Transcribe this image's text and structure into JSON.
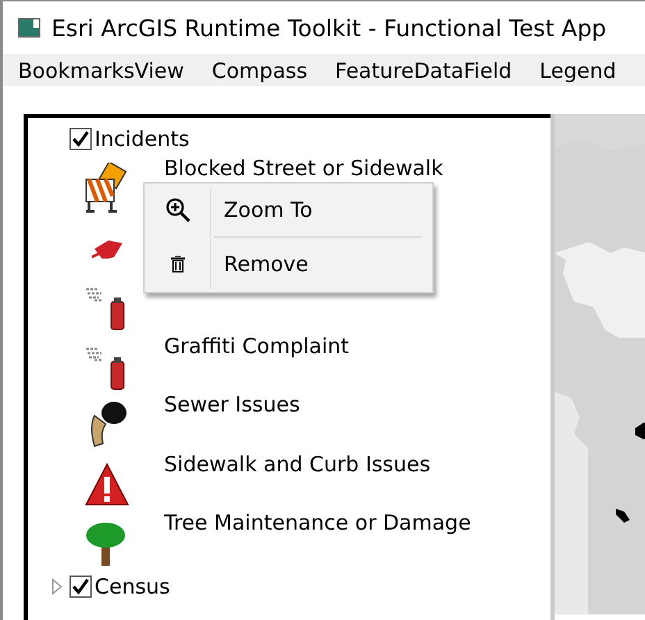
{
  "window": {
    "title": "Esri ArcGIS Runtime Toolkit - Functional Test App"
  },
  "menu_bar": [
    "BookmarksView",
    "Compass",
    "FeatureDataField",
    "Legend"
  ],
  "legend": {
    "layers": [
      {
        "label": "Incidents",
        "checked": true,
        "expanded": true,
        "children": [
          {
            "label": "Blocked Street or Sidewalk",
            "kind": "barricade"
          },
          {
            "kind": "leaf"
          },
          {
            "kind": "spray"
          },
          {
            "label": "Graffiti Complaint",
            "kind": "spray"
          },
          {
            "label": "Sewer Issues",
            "kind": "pipe"
          },
          {
            "label": "Sidewalk and Curb Issues",
            "kind": "warning"
          },
          {
            "label": "Tree Maintenance or Damage",
            "kind": "tree"
          }
        ]
      },
      {
        "label": "Census",
        "checked": true,
        "expanded": false
      }
    ]
  },
  "context_menu": {
    "items": [
      {
        "label": "Zoom To",
        "kind": "zoom"
      },
      {
        "label": "Remove",
        "kind": "remove"
      }
    ]
  }
}
